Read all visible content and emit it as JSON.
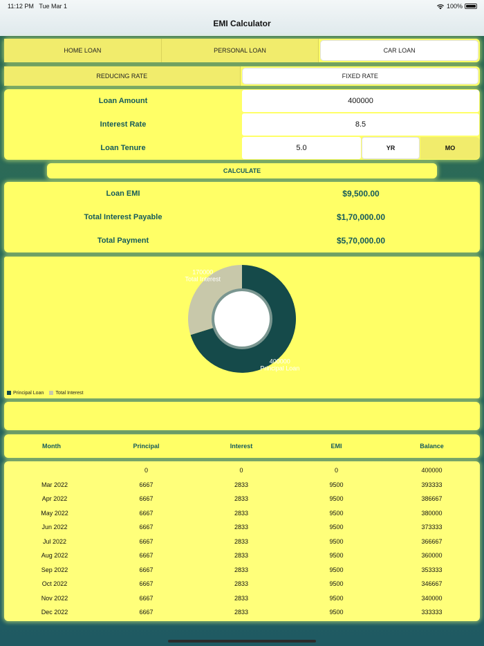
{
  "status": {
    "time": "11:12 PM",
    "date": "Tue Mar 1",
    "battery": "100%"
  },
  "nav": {
    "title": "EMI Calculator"
  },
  "loan_tabs": [
    {
      "label": "HOME LOAN",
      "active": false
    },
    {
      "label": "PERSONAL LOAN",
      "active": false
    },
    {
      "label": "CAR LOAN",
      "active": true
    }
  ],
  "rate_tabs": [
    {
      "label": "REDUCING RATE",
      "active": false
    },
    {
      "label": "FIXED RATE",
      "active": true
    }
  ],
  "form": {
    "amount_label": "Loan Amount",
    "amount_value": "400000",
    "rate_label": "Interest Rate",
    "rate_value": "8.5",
    "tenure_label": "Loan Tenure",
    "tenure_value": "5.0",
    "unit_year": "YR",
    "unit_month": "MO",
    "selected_unit": "YR"
  },
  "calculate_label": "CALCULATE",
  "results": {
    "emi_label": "Loan EMI",
    "emi_value": "$9,500.00",
    "interest_label": "Total Interest Payable",
    "interest_value": "$1,70,000.00",
    "payment_label": "Total Payment",
    "payment_value": "$5,70,000.00"
  },
  "chart_data": {
    "type": "pie",
    "categories": [
      "Principal Loan",
      "Total Interest"
    ],
    "values": [
      400000,
      170000
    ],
    "colors": [
      "#154a4a",
      "#c8c8aa"
    ],
    "value_labels": [
      "400000",
      "170000"
    ],
    "legend": "bottom-left",
    "donut": true
  },
  "colors": {
    "panel": "#ffff66",
    "accent": "#155a5a",
    "chart_principal": "#154a4a",
    "chart_interest": "#c8c8aa"
  },
  "table": {
    "headers": [
      "Month",
      "Principal",
      "Interest",
      "EMI",
      "Balance"
    ],
    "rows": [
      [
        "",
        "0",
        "0",
        "0",
        "400000"
      ],
      [
        "Mar 2022",
        "6667",
        "2833",
        "9500",
        "393333"
      ],
      [
        "Apr 2022",
        "6667",
        "2833",
        "9500",
        "386667"
      ],
      [
        "May 2022",
        "6667",
        "2833",
        "9500",
        "380000"
      ],
      [
        "Jun 2022",
        "6667",
        "2833",
        "9500",
        "373333"
      ],
      [
        "Jul 2022",
        "6667",
        "2833",
        "9500",
        "366667"
      ],
      [
        "Aug 2022",
        "6667",
        "2833",
        "9500",
        "360000"
      ],
      [
        "Sep 2022",
        "6667",
        "2833",
        "9500",
        "353333"
      ],
      [
        "Oct 2022",
        "6667",
        "2833",
        "9500",
        "346667"
      ],
      [
        "Nov 2022",
        "6667",
        "2833",
        "9500",
        "340000"
      ],
      [
        "Dec 2022",
        "6667",
        "2833",
        "9500",
        "333333"
      ]
    ]
  }
}
